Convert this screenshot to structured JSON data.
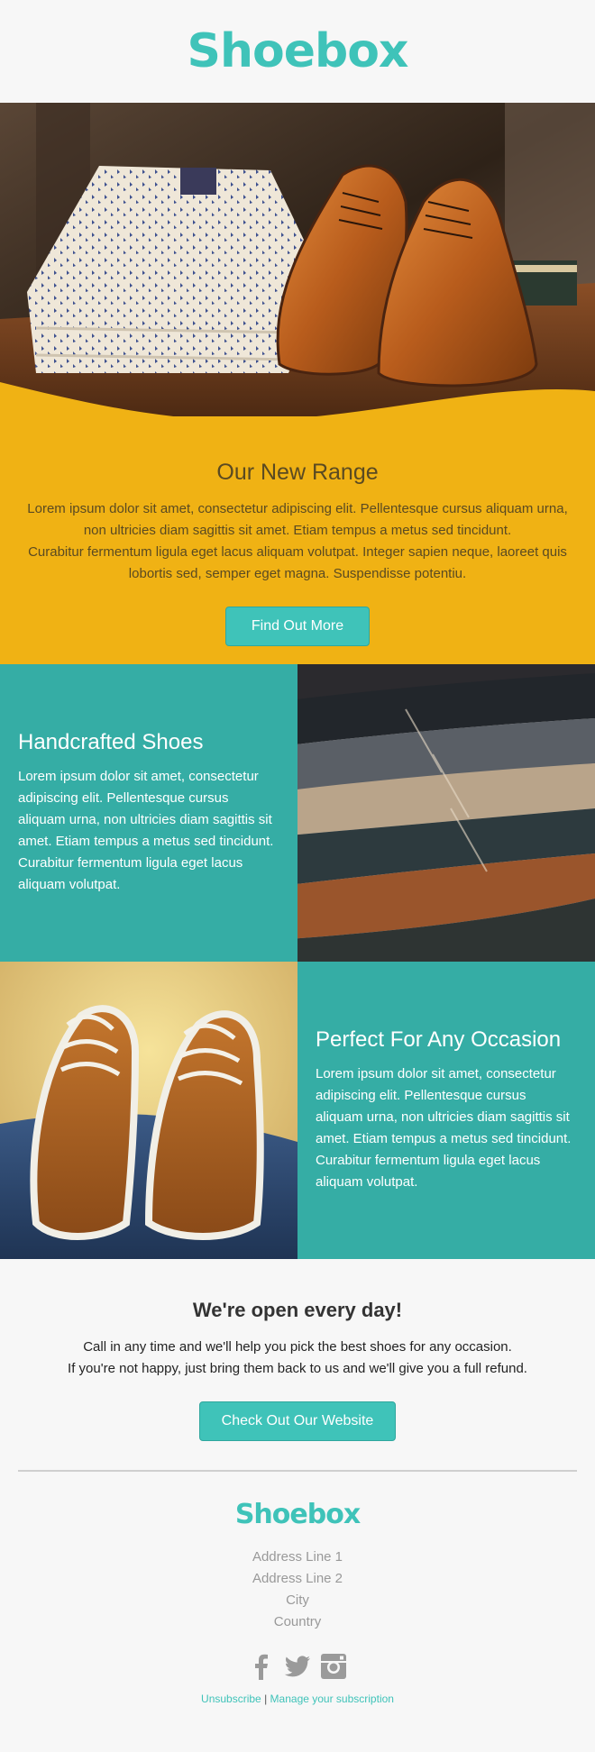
{
  "brand": {
    "logo": "Shoebox",
    "accent_color": "#3fc3b9",
    "yellow_color": "#f0b214",
    "teal_color": "#35ada5"
  },
  "range": {
    "title": "Our New Range",
    "line1": "Lorem ipsum dolor sit amet, consectetur adipiscing elit. Pellentesque cursus aliquam urna, non ultricies diam sagittis sit amet. Etiam tempus a metus sed tincidunt.",
    "line2": "Curabitur fermentum ligula eget lacus aliquam volutpat. Integer sapien neque, laoreet quis lobortis sed, semper eget magna. Suspendisse potentiu.",
    "button": "Find Out More"
  },
  "handcrafted": {
    "title": "Handcrafted Shoes",
    "text": "Lorem ipsum dolor sit amet, consectetur adipiscing elit. Pellentesque cursus aliquam urna, non ultricies diam sagittis sit amet. Etiam tempus a metus sed tincidunt. Curabitur fermentum ligula eget lacus aliquam volutpat."
  },
  "occasion": {
    "title": "Perfect For Any Occasion",
    "text": "Lorem ipsum dolor sit amet, consectetur adipiscing elit. Pellentesque cursus aliquam urna, non ultricies diam sagittis sit amet. Etiam tempus a metus sed tincidunt. Curabitur fermentum ligula eget lacus aliquam volutpat."
  },
  "open": {
    "title": "We're open every day!",
    "line1": "Call in any time and we'll help you pick the best shoes for any occasion.",
    "line2": "If you're not happy, just bring them back to us and we'll give you a full refund.",
    "button": "Check Out Our Website"
  },
  "footer": {
    "logo": "Shoebox",
    "address": [
      "Address Line 1",
      "Address Line 2",
      "City",
      "Country"
    ],
    "social": [
      "facebook-icon",
      "twitter-icon",
      "instagram-icon"
    ],
    "unsubscribe": "Unsubscribe",
    "separator": "|",
    "manage": "Manage your subscription"
  }
}
